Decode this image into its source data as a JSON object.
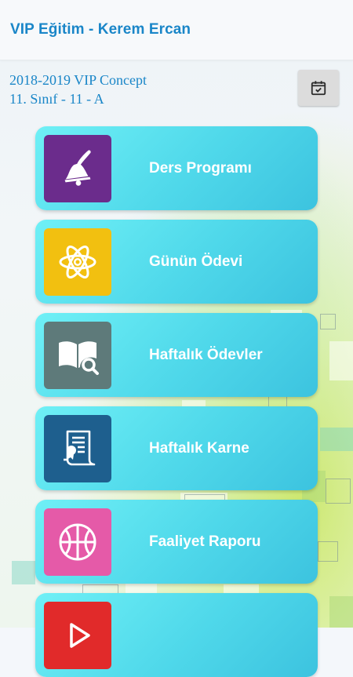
{
  "app": {
    "title": "VIP Eğitim - Kerem Ercan"
  },
  "info": {
    "line1": "2018-2019 VIP Concept",
    "line2": "11. Sınıf - 11 - A"
  },
  "calendar_button": {
    "icon": "calendar-check-icon"
  },
  "menu": [
    {
      "label": "Ders Programı",
      "icon": "bell-icon",
      "color": "#6b2c8c"
    },
    {
      "label": "Günün Ödevi",
      "icon": "atom-icon",
      "color": "#f2c010"
    },
    {
      "label": "Haftalık Ödevler",
      "icon": "book-search-icon",
      "color": "#5e7a7a"
    },
    {
      "label": "Haftalık Karne",
      "icon": "certificate-scroll-icon",
      "color": "#1e5f8e"
    },
    {
      "label": "Faaliyet Raporu",
      "icon": "basketball-icon",
      "color": "#e55aa8"
    },
    {
      "label": "",
      "icon": "play-icon",
      "color": "#e12a2a"
    }
  ]
}
